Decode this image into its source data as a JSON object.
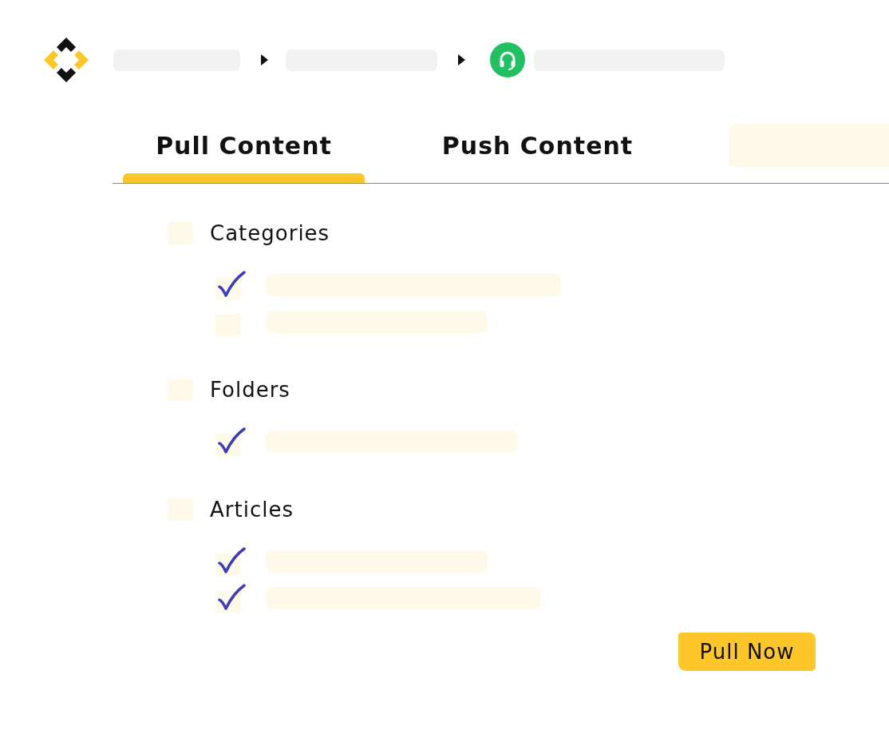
{
  "tabs": [
    {
      "label": "Pull Content",
      "selected": true
    },
    {
      "label": "Push Content",
      "selected": false
    }
  ],
  "sections": [
    {
      "label": "Categories",
      "checked": false,
      "items": [
        {
          "checked": true
        },
        {
          "checked": false
        }
      ]
    },
    {
      "label": "Folders",
      "checked": false,
      "items": [
        {
          "checked": true
        }
      ]
    },
    {
      "label": "Articles",
      "checked": false,
      "items": [
        {
          "checked": true
        },
        {
          "checked": true
        }
      ]
    }
  ],
  "button": {
    "label": "Pull Now"
  }
}
